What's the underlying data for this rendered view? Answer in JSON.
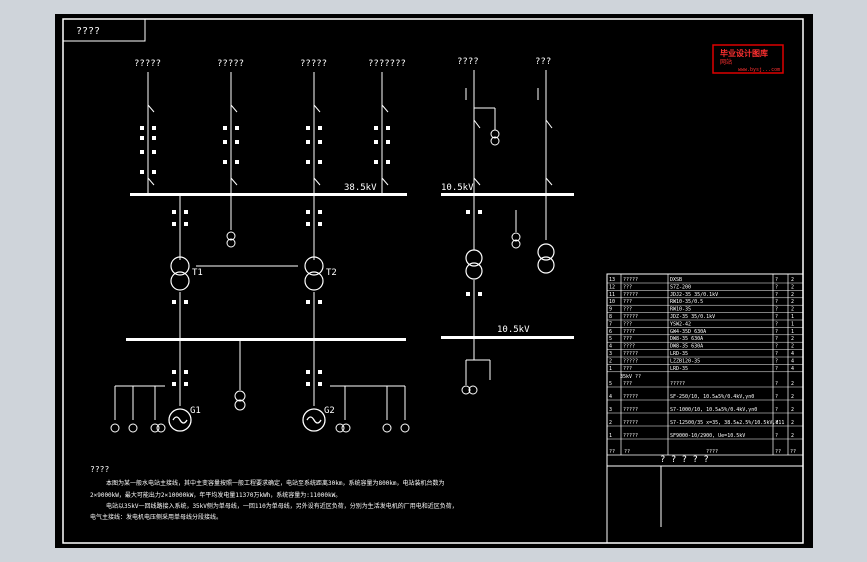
{
  "title_box": "????",
  "stamp": {
    "line1": "毕业设计图库",
    "line2": "网站",
    "line3": "www.bysj...com"
  },
  "bus_labels": {
    "hv": "38.5kV",
    "lv_top": "10.5kV",
    "lv_main": "10.5kV"
  },
  "feeders_left": [
    "?????",
    "?????",
    "?????",
    "???????"
  ],
  "feeders_right": [
    "????",
    "???"
  ],
  "transformers": {
    "t1": "T1",
    "t2": "T2"
  },
  "generators": {
    "g1": "G1",
    "g2": "G2"
  },
  "notes": {
    "title": "????",
    "line1": "本图为某一般水电站主接线，其中主变容量按照一般工程要求确定，电站至系统距离30km，系统容量为800km，电站装机台数为",
    "line2": "2×9000kW，最大可能出力2×10000kW，年平均发电量11370万kWh，系统容量为:11000kW。",
    "line3": "电站以35kV一回线路接入系统，35kV侧为单母线，一回110为单母线，另外设有近区负荷，分别为生活发电机的厂用电和近区负荷，",
    "line4": "电气主接线：发电机电压侧采用单母线分段接线。"
  },
  "table_rows": [
    {
      "no": "13",
      "name": "?????",
      "model": "DXSB",
      "qty": "?",
      "unit": "2"
    },
    {
      "no": "12",
      "name": "???",
      "model": "S7Z-200",
      "qty": "?",
      "unit": "2"
    },
    {
      "no": "11",
      "name": "?????",
      "model": "JDJ2-35  35/0.1kV",
      "qty": "?",
      "unit": "2"
    },
    {
      "no": "10",
      "name": "???",
      "model": "RW10-35/0.5",
      "qty": "?",
      "unit": "2"
    },
    {
      "no": "9",
      "name": "???",
      "model": "RW10-35",
      "qty": "?",
      "unit": "2"
    },
    {
      "no": "8",
      "name": "?????",
      "model": "JDZ-35 35/0.1kV",
      "qty": "?",
      "unit": "1"
    },
    {
      "no": "7",
      "name": "???",
      "model": "YSW2-42",
      "qty": "?",
      "unit": "1"
    },
    {
      "no": "6",
      "name": "????",
      "model": "GW4-35D 630A",
      "qty": "?",
      "unit": "1"
    },
    {
      "no": "5",
      "name": "???",
      "model": "DW8-35 630A",
      "qty": "?",
      "unit": "2"
    },
    {
      "no": "4",
      "name": "????",
      "model": "DW8-35 630A",
      "qty": "?",
      "unit": "2"
    },
    {
      "no": "3",
      "name": "?????",
      "model": "LRD-35",
      "qty": "?",
      "unit": "4"
    },
    {
      "no": "2",
      "name": "?????",
      "model": "LZZB120-35",
      "qty": "?",
      "unit": "4"
    },
    {
      "no": "1",
      "name": "???",
      "model": "LRD-35",
      "qty": "?",
      "unit": "4"
    }
  ],
  "table_sub": "35kV ??",
  "table_rows_b": [
    {
      "no": "5",
      "name": "???",
      "model": "?????",
      "qty": "?",
      "unit": "2"
    },
    {
      "no": "4",
      "name": "?????",
      "model": "SF-250/10, 10.5±5%/0.4kV,γn0",
      "qty": "?",
      "unit": "2"
    },
    {
      "no": "3",
      "name": "?????",
      "model": "S7-1000/10, 10.5±5%/0.4kV,γn0",
      "qty": "?",
      "unit": "2"
    },
    {
      "no": "2",
      "name": "?????",
      "model": "S7-12500/35 x=35, 38.5±2.5%/10.5kV,d11",
      "qty": "?",
      "unit": "2"
    },
    {
      "no": "1",
      "name": "?????",
      "model": "SF9000-10/2900, Ue=10.5kV",
      "qty": "?",
      "unit": "2"
    }
  ],
  "table_footer": {
    "col1": "??",
    "col2": "??",
    "col3": "????",
    "col4": "??",
    "col5": "??"
  },
  "title_block": "? ? ? ? ?"
}
